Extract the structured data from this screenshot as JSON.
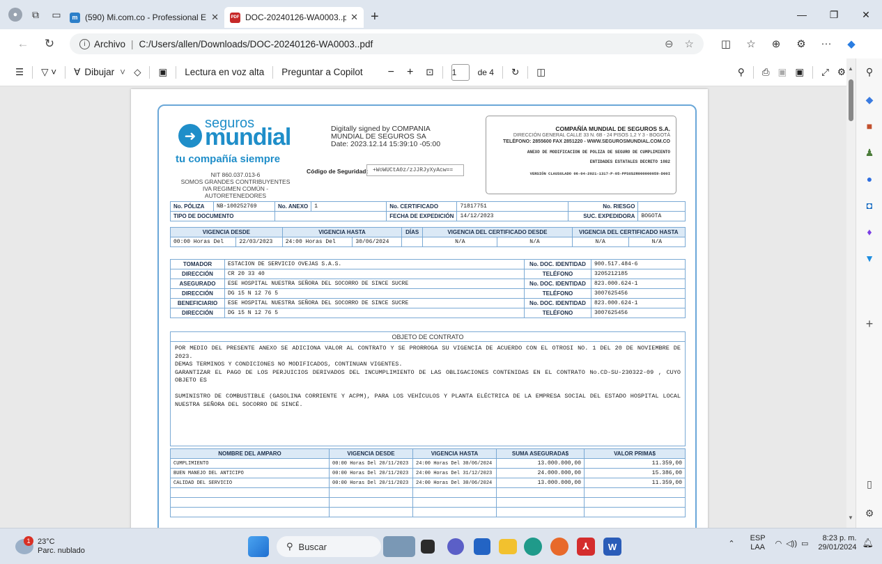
{
  "tabs": [
    {
      "label": "(590) Mi.com.co - Professional E",
      "favicon": "m"
    },
    {
      "label": "DOC-20240126-WA0003..pdf",
      "favicon": "PDF"
    }
  ],
  "address": {
    "label": "Archivo",
    "url": "C:/Users/allen/Downloads/DOC-20240126-WA0003..pdf"
  },
  "pdf_toolbar": {
    "draw": "Dibujar",
    "read_aloud": "Lectura en voz alta",
    "copilot": "Preguntar a Copilot",
    "minus": "−",
    "plus": "+",
    "page": "1",
    "page_total": "de 4"
  },
  "doc": {
    "logo": {
      "seguros": "seguros",
      "mundial": "mundial",
      "tagline": "tu compañía siempre"
    },
    "nit": [
      "NIT 860.037.013-6",
      "SOMOS GRANDES CONTRIBUYENTES",
      "IVA REGIMEN COMÚN - AUTORETENEDORES"
    ],
    "signature": [
      "Digitally signed by COMPANIA",
      "MUNDIAL DE SEGUROS SA",
      "Date: 2023.12.14 15:39:10 -05:00"
    ],
    "codigo_label": "Código de Seguridad:",
    "codigo_value": "+WoWUCtA0z/zJJRJyXyAcw==",
    "company": {
      "name": "COMPAÑÍA MUNDIAL DE SEGUROS S.A.",
      "addr": "DIRECCIÓN GENERAL CALLE 33 N. 6B - 24 PISOS 1,2 Y 3 - BOGOTÁ",
      "phone": "TELÉFONO: 2855600 FAX 2851220 - WWW.SEGUROSMUNDIAL.COM.CO",
      "anexo": "ANEXO DE MODIFICACION DE POLIZA DE SEGURO DE CUMPLIMIENTO",
      "entidades": "ENTIDADES ESTATALES DECRETO 1082",
      "version": "VERSIÓN CLAUSULADO 06-04-2021-1317-P-05-PPSUS2R000000059-D00I"
    },
    "poliza": {
      "l_poliza": "No. PÓLIZA",
      "poliza": "NB-100252769",
      "l_anexo": "No. ANEXO",
      "anexo": "1",
      "l_cert": "No. CERTIFICADO",
      "cert": "71817751",
      "l_riesgo": "No. RIESGO",
      "riesgo": "",
      "l_tipo": "TIPO DE DOCUMENTO",
      "tipo": "",
      "l_fecha": "FECHA DE EXPEDICIÓN",
      "fecha": "14/12/2023",
      "l_suc": "SUC. EXPEDIDORA",
      "suc": "BOGOTA",
      "h_desde": "VIGENCIA DESDE",
      "h_hasta": "VIGENCIA HASTA",
      "h_dias": "DÍAS",
      "h_cdesde": "VIGENCIA DEL CERTIFICADO DESDE",
      "h_chasta": "VIGENCIA DEL CERTIFICADO HASTA",
      "v1": "00:00 Horas Del",
      "v2": "22/03/2023",
      "v3": "24:00 Horas Del",
      "v4": "30/06/2024",
      "na": "N/A"
    },
    "partes": [
      {
        "label": "TOMADOR",
        "value": "ESTACION DE SERVICIO OVEJAS S.A.S.",
        "rlabel": "No. DOC. IDENTIDAD",
        "rvalue": "900.517.484-6"
      },
      {
        "label": "DIRECCIÓN",
        "value": "CR 20 33 40",
        "rlabel": "TELÉFONO",
        "rvalue": "3205212185"
      },
      {
        "label": "ASEGURADO",
        "value": "ESE HOSPITAL NUESTRA SEÑORA DEL SOCORRO DE SINCE SUCRE",
        "rlabel": "No. DOC. IDENTIDAD",
        "rvalue": "823.000.624-1"
      },
      {
        "label": "DIRECCIÓN",
        "value": "DG 15 N 12 76 5",
        "rlabel": "TELÉFONO",
        "rvalue": "3007625456"
      },
      {
        "label": "BENEFICIARIO",
        "value": "ESE HOSPITAL NUESTRA SEÑORA DEL SOCORRO DE SINCE SUCRE",
        "rlabel": "No. DOC. IDENTIDAD",
        "rvalue": "823.000.624-1"
      },
      {
        "label": "DIRECCIÓN",
        "value": "DG 15 N 12 76 5",
        "rlabel": "TELÉFONO",
        "rvalue": "3007625456"
      }
    ],
    "objeto_title": "OBJETO DE CONTRATO",
    "objeto_text": "POR MEDIO DEL PRESENTE ANEXO SE ADICIONA VALOR AL CONTRATO Y SE PRORROGA SU VIGENCIA DE ACUERDO CON EL OTROSI NO. 1 DEL 20 DE NOVIEMBRE DE 2023.\nDEMAS TERMINOS Y CONDICIONES NO MODIFICADOS, CONTINUAN VIGENTES.\nGARANTIZAR EL PAGO DE LOS PERJUICIOS DERIVADOS DEL INCUMPLIMIENTO DE LAS OBLIGACIONES CONTENIDAS EN EL CONTRATO No.CD-SU-230322-09 , CUYO OBJETO ES\n\nSUMINISTRO DE COMBUSTIBLE (GASOLINA CORRIENTE Y ACPM), PARA LOS VEHÍCULOS Y PLANTA ELÉCTRICA DE LA EMPRESA SOCIAL DEL ESTADO HOSPITAL LOCAL NUESTRA SEÑORA DEL SOCORRO DE SINCÉ.",
    "amparos_headers": [
      "NOMBRE DEL AMPARO",
      "VIGENCIA DESDE",
      "VIGENCIA HASTA",
      "SUMA ASEGURADA$",
      "VALOR PRIMA$"
    ],
    "amparos": [
      [
        "CUMPLIMIENTO",
        "00:00 Horas Del 20/11/2023",
        "24:00 Horas Del 30/06/2024",
        "13.000.000,00",
        "11.359,00"
      ],
      [
        "BUEN MANEJO DEL ANTICIPO",
        "00:00 Horas Del 20/11/2023",
        "24:00 Horas Del 31/12/2023",
        "24.000.000,00",
        "15.386,00"
      ],
      [
        "CALIDAD DEL SERVICIO",
        "00:00 Horas Del 20/11/2023",
        "24:00 Horas Del 30/06/2024",
        "13.000.000,00",
        "11.359,00"
      ]
    ]
  },
  "taskbar": {
    "temp": "23°C",
    "weather": "Parc. nublado",
    "badge": "1",
    "search": "Buscar",
    "lang1": "ESP",
    "lang2": "LAA",
    "time": "8:23 p. m.",
    "date": "29/01/2024"
  }
}
